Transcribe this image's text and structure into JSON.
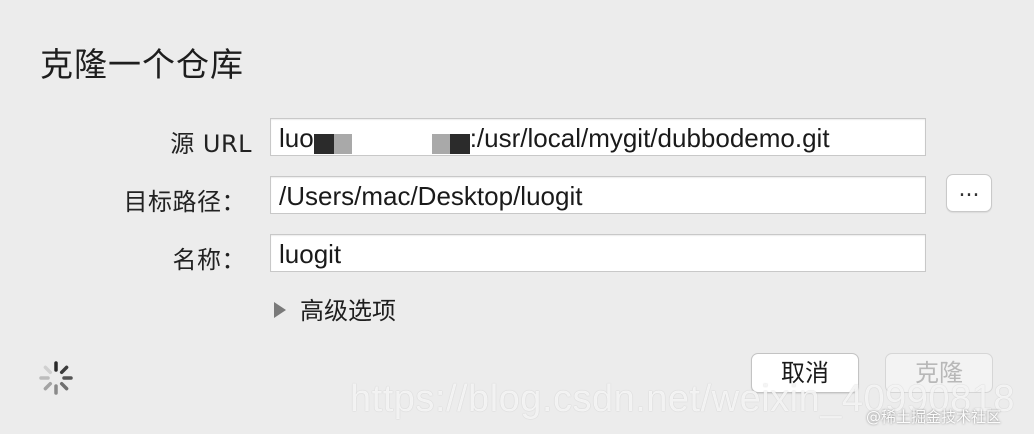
{
  "dialog": {
    "title": "克隆一个仓库"
  },
  "fields": {
    "source_url": {
      "label": "源 URL",
      "value_prefix": "luo",
      "value_suffix": ":/usr/local/mygit/dubbodemo.git"
    },
    "target_path": {
      "label": "目标路径：",
      "value": "/Users/mac/Desktop/luogit",
      "browse_label": "..."
    },
    "name": {
      "label": "名称：",
      "value": "luogit"
    }
  },
  "advanced": {
    "label": "高级选项"
  },
  "buttons": {
    "cancel_label": "取消",
    "clone_label": "克隆"
  },
  "watermarks": {
    "url": "https://blog.csdn.net/weixin_40990818",
    "site": "@稀土掘金技术社区"
  },
  "colors": {
    "window_bg": "#ececec",
    "field_bg": "#ffffff",
    "disabled_text": "#b8b8b8"
  },
  "icons": {
    "spinner": "loading-spinner-icon",
    "disclosure": "disclosure-triangle-icon"
  }
}
